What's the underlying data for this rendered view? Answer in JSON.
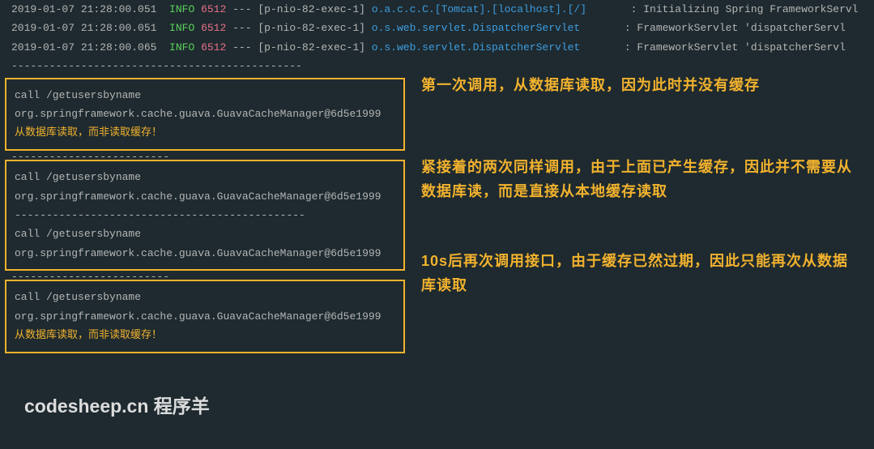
{
  "logs": [
    {
      "date": "2019-01-07 21:28:00.051",
      "level": "INFO",
      "pid": "6512",
      "thread": "[p-nio-82-exec-1]",
      "logger": "o.a.c.c.C.[Tomcat].[localhost].[/]    ",
      "msg": ": Initializing Spring FrameworkServl"
    },
    {
      "date": "2019-01-07 21:28:00.051",
      "level": "INFO",
      "pid": "6512",
      "thread": "[p-nio-82-exec-1]",
      "logger": "o.s.web.servlet.DispatcherServlet    ",
      "msg": ": FrameworkServlet 'dispatcherServl"
    },
    {
      "date": "2019-01-07 21:28:00.065",
      "level": "INFO",
      "pid": "6512",
      "thread": "[p-nio-82-exec-1]",
      "logger": "o.s.web.servlet.DispatcherServlet    ",
      "msg": ": FrameworkServlet 'dispatcherServl"
    }
  ],
  "sep1": "----------------------------------------------",
  "box1": {
    "l1": "call /getusersbyname",
    "l2": "org.springframework.cache.guava.GuavaCacheManager@6d5e1999",
    "l3": "从数据库读取，而非读取缓存！"
  },
  "sep2": "-------------------------",
  "box2": {
    "l1": "call /getusersbyname",
    "l2": "org.springframework.cache.guava.GuavaCacheManager@6d5e1999",
    "sep": "----------------------------------------------",
    "l3": "call /getusersbyname",
    "l4": "org.springframework.cache.guava.GuavaCacheManager@6d5e1999"
  },
  "sep3": "-------------------------",
  "box3": {
    "l1": "call /getusersbyname",
    "l2": "org.springframework.cache.guava.GuavaCacheManager@6d5e1999",
    "l3": "从数据库读取，而非读取缓存！"
  },
  "annotations": {
    "a1": "第一次调用，从数据库读取，因为此时并没有缓存",
    "a2": "紧接着的两次同样调用，由于上面已产生缓存，因此并不需要从数据库读，而是直接从本地缓存读取",
    "a3": "10s后再次调用接口，由于缓存已然过期，因此只能再次从数据库读取"
  },
  "watermark": "codesheep.cn 程序羊"
}
